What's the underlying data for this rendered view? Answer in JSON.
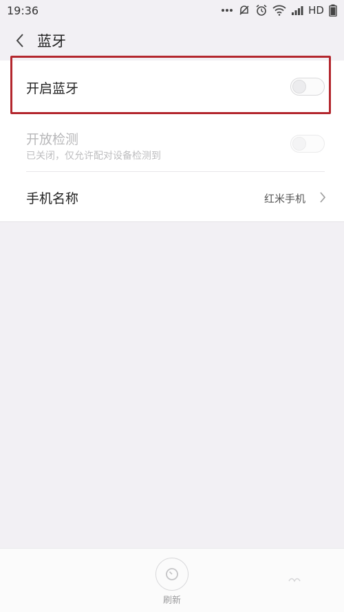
{
  "status": {
    "time": "19:36",
    "network": "HD"
  },
  "header": {
    "title": "蓝牙"
  },
  "settings": {
    "bluetooth": {
      "label": "开启蓝牙",
      "enabled": false
    },
    "visibility": {
      "label": "开放检测",
      "subtitle": "已关闭，仅允许配对设备检测到",
      "enabled": false
    },
    "device_name": {
      "label": "手机名称",
      "value": "红米手机"
    }
  },
  "bottom_bar": {
    "refresh_label": "刷新"
  },
  "colors": {
    "highlight": "#b3262d",
    "background": "#f2f0f4"
  }
}
